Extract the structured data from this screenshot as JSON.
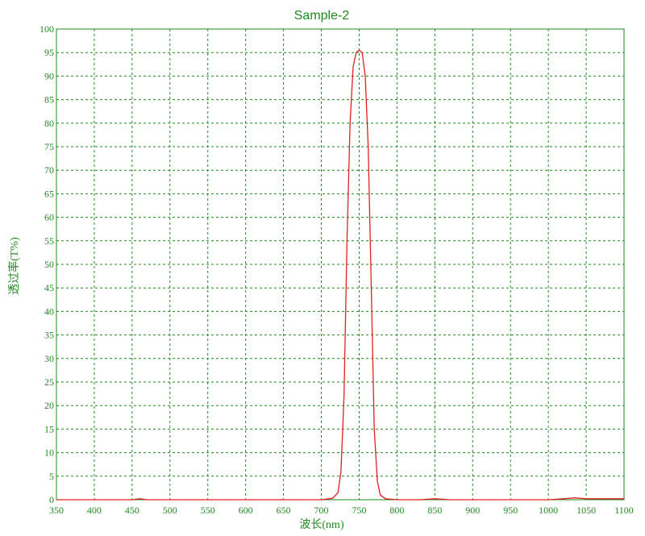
{
  "chart_data": {
    "type": "line",
    "title": "Sample-2",
    "xlabel": "波长(nm)",
    "ylabel": "透过率(T%)",
    "xlim": [
      350,
      1100
    ],
    "ylim": [
      0,
      100
    ],
    "x_ticks": [
      350,
      400,
      450,
      500,
      550,
      600,
      650,
      700,
      750,
      800,
      850,
      900,
      950,
      1000,
      1050,
      1100
    ],
    "y_ticks": [
      0,
      5,
      10,
      15,
      20,
      25,
      30,
      35,
      40,
      45,
      50,
      55,
      60,
      65,
      70,
      75,
      80,
      85,
      90,
      95,
      100
    ],
    "grid": true,
    "grid_style": "dashed",
    "series": [
      {
        "color": "#e02020",
        "x": [
          350,
          400,
          450,
          460,
          470,
          500,
          550,
          600,
          650,
          700,
          715,
          722,
          726,
          730,
          734,
          738,
          742,
          746,
          750,
          754,
          758,
          762,
          766,
          770,
          774,
          778,
          785,
          800,
          830,
          850,
          870,
          900,
          950,
          1000,
          1020,
          1035,
          1050,
          1100
        ],
        "y": [
          0,
          0,
          0,
          0.2,
          0,
          0,
          0,
          0,
          0,
          0,
          0.3,
          1.5,
          6,
          22,
          55,
          80,
          92,
          95,
          95.5,
          95,
          90,
          75,
          45,
          15,
          4,
          1,
          0.2,
          0,
          0,
          0.2,
          0,
          0,
          0,
          0,
          0.2,
          0.4,
          0.2,
          0.2
        ]
      }
    ]
  },
  "colors": {
    "grid": "#1f8a1f",
    "text": "#1f8a1f",
    "line": "#e02020"
  }
}
